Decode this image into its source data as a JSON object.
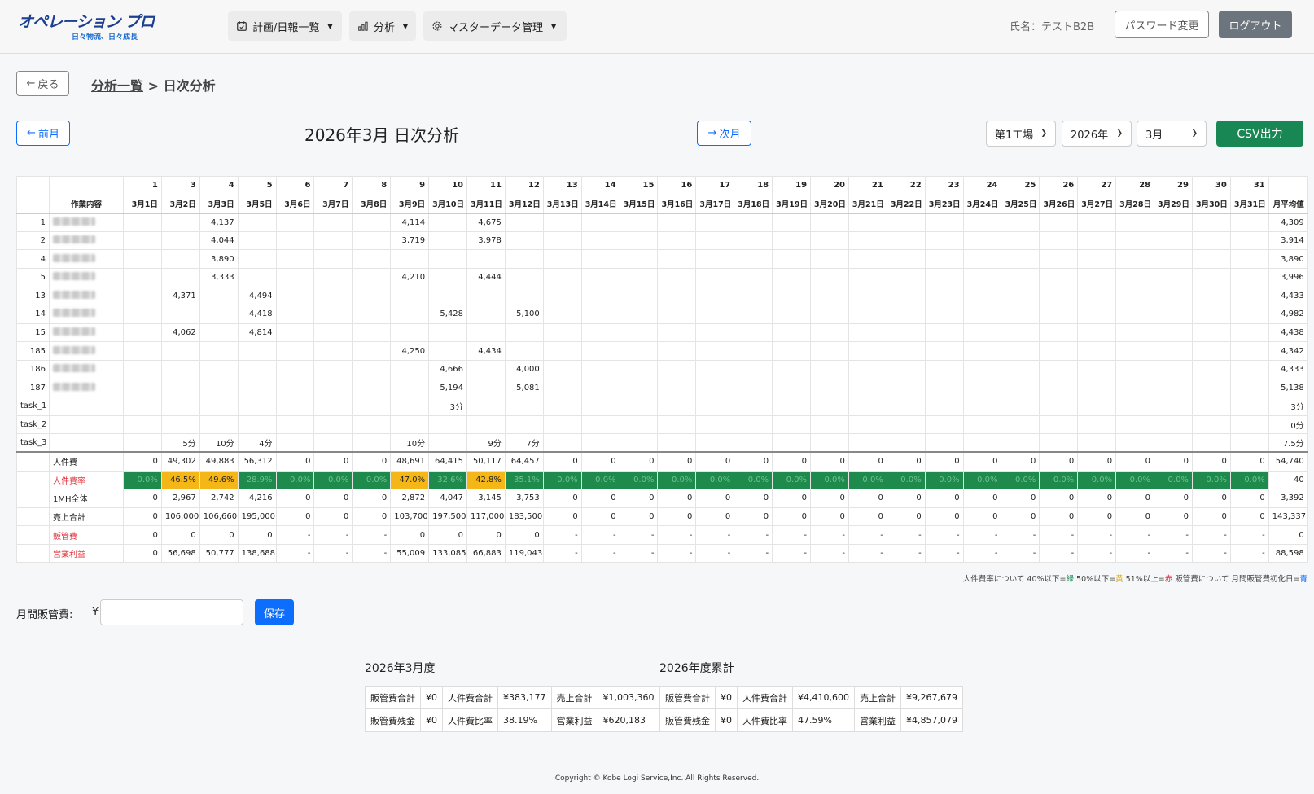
{
  "header": {
    "logo_main": "オペレーション プロ",
    "logo_sub": "日々物流、日々成長",
    "nav": [
      {
        "label": "計画/日報一覧",
        "icon": "calendar-icon"
      },
      {
        "label": "分析",
        "icon": "bar-chart-icon"
      },
      {
        "label": "マスターデータ管理",
        "icon": "gear-icon"
      }
    ],
    "user": "氏名：テストB2B",
    "password_button": "パスワード変更",
    "logout_button": "ログアウト"
  },
  "breadcrumb": {
    "back_button": "戻る",
    "parent": "分析一覧",
    "separator": ">",
    "current": "日次分析"
  },
  "toolbar": {
    "prev_button": "前月",
    "next_button": "次月",
    "title": "2026年3月 日次分析",
    "factory": "第1工場",
    "year": "2026年",
    "month": "3月",
    "csv_button": "CSV出力"
  },
  "colors": {
    "green": "#1e8a4c",
    "yellow": "#f5b617",
    "red": "#e0303a",
    "primary": "#0d6efd",
    "csv": "#198754"
  },
  "table": {
    "day_numbers": [
      "1",
      "3",
      "4",
      "5",
      "6",
      "7",
      "8",
      "9",
      "10",
      "11",
      "12",
      "13",
      "14",
      "15",
      "16",
      "17",
      "18",
      "19",
      "20",
      "21",
      "22",
      "23",
      "24",
      "25",
      "26",
      "27",
      "28",
      "29",
      "30",
      "31"
    ],
    "task_header": "作業内容",
    "date_labels": [
      "3月1日",
      "3月2日",
      "3月3日",
      "3月5日",
      "3月6日",
      "3月7日",
      "3月8日",
      "3月9日",
      "3月10日",
      "3月11日",
      "3月12日",
      "3月13日",
      "3月14日",
      "3月15日",
      "3月16日",
      "3月17日",
      "3月18日",
      "3月19日",
      "3月20日",
      "3月21日",
      "3月22日",
      "3月23日",
      "3月24日",
      "3月25日",
      "3月26日",
      "3月27日",
      "3月28日",
      "3月29日",
      "3月30日",
      "3月31日"
    ],
    "avg_header": "月平均値",
    "rows": [
      {
        "id": "1",
        "blur": true,
        "cells": {
          "2": "4,137",
          "7": "4,114",
          "9": "4,675"
        },
        "avg": "4,309"
      },
      {
        "id": "2",
        "blur": true,
        "cells": {
          "2": "4,044",
          "7": "3,719",
          "9": "3,978"
        },
        "avg": "3,914"
      },
      {
        "id": "4",
        "blur": true,
        "cells": {
          "2": "3,890"
        },
        "avg": "3,890"
      },
      {
        "id": "5",
        "blur": true,
        "cells": {
          "2": "3,333",
          "7": "4,210",
          "9": "4,444"
        },
        "avg": "3,996"
      },
      {
        "id": "13",
        "blur": true,
        "cells": {
          "1": "4,371",
          "3": "4,494"
        },
        "avg": "4,433"
      },
      {
        "id": "14",
        "blur": true,
        "cells": {
          "3": "4,418",
          "8": "5,428",
          "10": "5,100"
        },
        "avg": "4,982"
      },
      {
        "id": "15",
        "blur": true,
        "cells": {
          "1": "4,062",
          "3": "4,814"
        },
        "avg": "4,438"
      },
      {
        "id": "185",
        "blur": true,
        "cells": {
          "7": "4,250",
          "9": "4,434"
        },
        "avg": "4,342"
      },
      {
        "id": "186",
        "blur": true,
        "cells": {
          "8": "4,666",
          "10": "4,000"
        },
        "avg": "4,333"
      },
      {
        "id": "187",
        "blur": true,
        "cells": {
          "8": "5,194",
          "10": "5,081"
        },
        "avg": "5,138"
      },
      {
        "id": "task_1",
        "blur": false,
        "cells": {
          "8": "3分"
        },
        "avg": "3分"
      },
      {
        "id": "task_2",
        "blur": false,
        "cells": {},
        "avg": "0分"
      },
      {
        "id": "task_3",
        "blur": false,
        "cells": {
          "1": "5分",
          "2": "10分",
          "3": "4分",
          "7": "10分",
          "9": "9分",
          "10": "7分"
        },
        "avg": "7.5分"
      }
    ],
    "summary": [
      {
        "label": "人件費",
        "red": false,
        "first": "0",
        "cells": [
          "0",
          "49,302",
          "49,883",
          "56,312",
          "0",
          "0",
          "0",
          "48,691",
          "64,415",
          "50,117",
          "64,457",
          "0",
          "0",
          "0",
          "0",
          "0",
          "0",
          "0",
          "0",
          "0",
          "0",
          "0",
          "0",
          "0",
          "0",
          "0",
          "0",
          "0",
          "0",
          "0"
        ],
        "avg": "54,740"
      },
      {
        "label": "人件費率",
        "red": true,
        "first": "",
        "rate": true,
        "cells": [
          "0.0%",
          "46.5%",
          "49.6%",
          "28.9%",
          "0.0%",
          "0.0%",
          "0.0%",
          "47.0%",
          "32.6%",
          "42.8%",
          "35.1%",
          "0.0%",
          "0.0%",
          "0.0%",
          "0.0%",
          "0.0%",
          "0.0%",
          "0.0%",
          "0.0%",
          "0.0%",
          "0.0%",
          "0.0%",
          "0.0%",
          "0.0%",
          "0.0%",
          "0.0%",
          "0.0%",
          "0.0%",
          "0.0%",
          "0.0%"
        ],
        "first_rate": "0.0%",
        "styles": [
          "g",
          "y",
          "y",
          "g",
          "g",
          "g",
          "g",
          "y",
          "g",
          "y",
          "g",
          "g",
          "g",
          "g",
          "g",
          "g",
          "g",
          "g",
          "g",
          "g",
          "g",
          "g",
          "g",
          "g",
          "g",
          "g",
          "g",
          "g",
          "g",
          "g"
        ],
        "avg": "40"
      },
      {
        "label": "1MH全体",
        "red": false,
        "first": "0",
        "cells": [
          "0",
          "2,967",
          "2,742",
          "4,216",
          "0",
          "0",
          "0",
          "2,872",
          "4,047",
          "3,145",
          "3,753",
          "0",
          "0",
          "0",
          "0",
          "0",
          "0",
          "0",
          "0",
          "0",
          "0",
          "0",
          "0",
          "0",
          "0",
          "0",
          "0",
          "0",
          "0",
          "0"
        ],
        "avg": "3,392"
      },
      {
        "label": "売上合計",
        "red": false,
        "first": "0",
        "cells": [
          "0",
          "106,000",
          "106,660",
          "195,000",
          "0",
          "0",
          "0",
          "103,700",
          "197,500",
          "117,000",
          "183,500",
          "0",
          "0",
          "0",
          "0",
          "0",
          "0",
          "0",
          "0",
          "0",
          "0",
          "0",
          "0",
          "0",
          "0",
          "0",
          "0",
          "0",
          "0",
          "0"
        ],
        "avg": "143,337"
      },
      {
        "label": "販管費",
        "red": true,
        "first": "-",
        "cells": [
          "0",
          "0",
          "0",
          "0",
          "-",
          "-",
          "-",
          "0",
          "0",
          "0",
          "0",
          "-",
          "-",
          "-",
          "-",
          "-",
          "-",
          "-",
          "-",
          "-",
          "-",
          "-",
          "-",
          "-",
          "-",
          "-",
          "-",
          "-",
          "-",
          "-"
        ],
        "avg": "0"
      },
      {
        "label": "営業利益",
        "red": true,
        "first": "-",
        "cells": [
          "0",
          "56,698",
          "50,777",
          "138,688",
          "-",
          "-",
          "-",
          "55,009",
          "133,085",
          "66,883",
          "119,043",
          "-",
          "-",
          "-",
          "-",
          "-",
          "-",
          "-",
          "-",
          "-",
          "-",
          "-",
          "-",
          "-",
          "-",
          "-",
          "-",
          "-",
          "-",
          "-"
        ],
        "avg": "88,598"
      }
    ]
  },
  "legend": {
    "part1": "人件費率について 40%以下=",
    "green": "緑",
    "part2": " 50%以下=",
    "yellow": "黄",
    "part3": " 51%以上=",
    "red": "赤",
    "part4": " 販管費について 月間販管費初化日=",
    "blue": "青"
  },
  "sga": {
    "label": "月間販管費:",
    "yen": "¥",
    "value": "",
    "save_button": "保存"
  },
  "monthly": {
    "title": "2026年3月度",
    "rows": [
      [
        "販管費合計",
        "¥0",
        "人件費合計",
        "¥383,177",
        "売上合計",
        "¥1,003,360"
      ],
      [
        "販管費残金",
        "¥0",
        "人件費比率",
        "38.19%",
        "営業利益",
        "¥620,183"
      ]
    ]
  },
  "annual": {
    "title": "2026年度累計",
    "rows": [
      [
        "販管費合計",
        "¥0",
        "人件費合計",
        "¥4,410,600",
        "売上合計",
        "¥9,267,679"
      ],
      [
        "販管費残金",
        "¥0",
        "人件費比率",
        "47.59%",
        "営業利益",
        "¥4,857,079"
      ]
    ]
  },
  "footer": {
    "copyright": "Copyright © Kobe Logi Service,Inc. All Rights Reserved."
  }
}
